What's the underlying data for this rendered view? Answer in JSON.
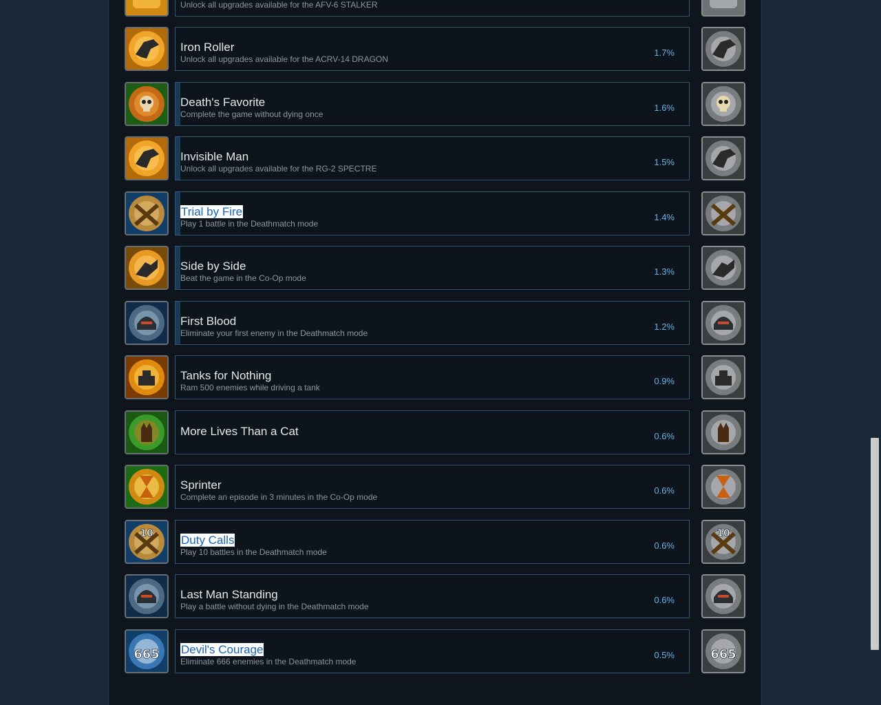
{
  "partial_top": {
    "desc": "Unlock all upgrades available for the AFV-6 STALKER"
  },
  "achievements": [
    {
      "name": "Iron Roller",
      "desc": "Unlock all upgrades available for the ACRV-14 DRAGON",
      "pct": "1.7%",
      "icon": "tank-icon",
      "progress": 0
    },
    {
      "name": "Death's Favorite",
      "desc": "Complete the game without dying once",
      "pct": "1.6%",
      "icon": "skull-icon",
      "progress": 0.01
    },
    {
      "name": "Invisible Man",
      "desc": "Unlock all upgrades available for the RG-2 SPECTRE",
      "pct": "1.5%",
      "icon": "aircraft-icon",
      "progress": 0.01
    },
    {
      "name": "Trial by Fire",
      "desc": "Play 1 battle in the Deathmatch mode",
      "pct": "1.4%",
      "icon": "crossed-guns-icon",
      "progress": 0.01,
      "highlighted": true
    },
    {
      "name": "Side by Side",
      "desc": "Beat the game in the Co-Op mode",
      "pct": "1.3%",
      "icon": "handshake-icon",
      "progress": 0.01
    },
    {
      "name": "First Blood",
      "desc": "Eliminate your first enemy in the Deathmatch mode",
      "pct": "1.2%",
      "icon": "helmet-icon",
      "progress": 0.01
    },
    {
      "name": "Tanks for Nothing",
      "desc": "Ram 500 enemies while driving a tank",
      "pct": "0.9%",
      "icon": "tank-front-icon",
      "progress": 0
    },
    {
      "name": "More Lives Than a Cat",
      "desc": "",
      "pct": "0.6%",
      "icon": "cat-icon",
      "progress": 0
    },
    {
      "name": "Sprinter",
      "desc": "Complete an episode in 3 minutes in the Co-Op mode",
      "pct": "0.6%",
      "icon": "hourglass-icon",
      "progress": 0
    },
    {
      "name": "Duty Calls",
      "desc": "Play 10 battles in the Deathmatch mode",
      "pct": "0.6%",
      "icon": "crossed-guns-10-icon",
      "badge": "10",
      "progress": 0,
      "highlighted": true
    },
    {
      "name": "Last Man Standing",
      "desc": "Play a battle without dying in the Deathmatch mode",
      "pct": "0.6%",
      "icon": "helmet-icon",
      "progress": 0
    },
    {
      "name": "Devil's Courage",
      "desc": "Eliminate 666 enemies in the Deathmatch mode",
      "pct": "0.5%",
      "icon": "number-666-icon",
      "badge": "665",
      "progress": 0,
      "highlighted": true
    }
  ],
  "colors": {
    "orange": "#e08a10",
    "green": "#2c8a20",
    "blue": "#1f5a94",
    "gray": "#7a7d80"
  }
}
